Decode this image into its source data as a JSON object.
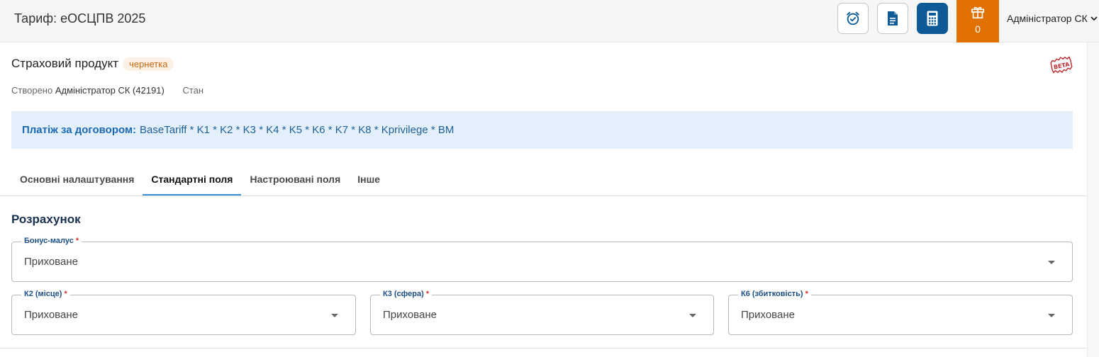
{
  "header": {
    "title": "Тариф: еОСЦПВ 2025",
    "buttons": [
      {
        "name": "alarm-clock-icon"
      },
      {
        "name": "document-icon"
      },
      {
        "name": "calculator-icon"
      }
    ],
    "gift": {
      "icon": "gift-icon",
      "count": "0"
    },
    "user": {
      "label": "Адміністратор СК",
      "icon": "chevron-down-icon"
    },
    "colors": {
      "gift_bg": "#e07000",
      "active_button": "#0d5a96"
    }
  },
  "product": {
    "title": "Страховий продукт",
    "status_badge": "чернетка",
    "beta_stamp": "BETA",
    "created_label": "Створено",
    "created_by": "Адміністратор СК (42191)",
    "state_label": "Стан"
  },
  "formula": {
    "label": "Платіж за договором:",
    "value": "BaseTariff * K1 * K2 * K3 * K4 * K5 * K6 * K7 * K8 * Kprivilege * BM"
  },
  "tabs": [
    {
      "label": "Основні налаштування",
      "active": false
    },
    {
      "label": "Стандартні поля",
      "active": true
    },
    {
      "label": "Настроювані поля",
      "active": false
    },
    {
      "label": "Інше",
      "active": false
    }
  ],
  "section": {
    "title": "Розрахунок"
  },
  "fields": [
    {
      "label": "Бонус-малус",
      "required": "*",
      "value": "Приховане"
    },
    {
      "label": "К2 (місце)",
      "required": "*",
      "value": "Приховане"
    },
    {
      "label": "К3 (сфера)",
      "required": "*",
      "value": "Приховане"
    },
    {
      "label": "К6 (збитковість)",
      "required": "*",
      "value": "Приховане"
    }
  ]
}
